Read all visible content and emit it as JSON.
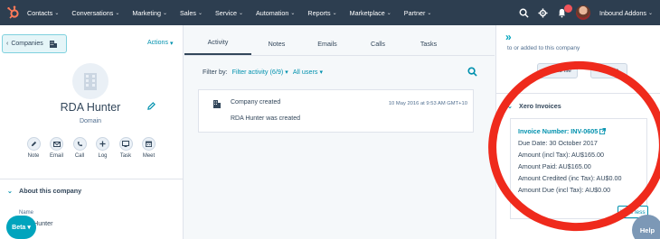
{
  "topnav": {
    "items": [
      {
        "label": "Contacts"
      },
      {
        "label": "Conversations"
      },
      {
        "label": "Marketing"
      },
      {
        "label": "Sales"
      },
      {
        "label": "Service"
      },
      {
        "label": "Automation"
      },
      {
        "label": "Reports"
      },
      {
        "label": "Marketplace"
      },
      {
        "label": "Partner"
      }
    ],
    "account_label": "Inbound Addons"
  },
  "left": {
    "back_label": "Companies",
    "actions_label": "Actions",
    "company_name": "RDA Hunter",
    "domain": "Domain",
    "action_buttons": [
      {
        "label": "Note",
        "icon": "note-icon"
      },
      {
        "label": "Email",
        "icon": "email-icon"
      },
      {
        "label": "Call",
        "icon": "call-icon"
      },
      {
        "label": "Log",
        "icon": "plus-icon"
      },
      {
        "label": "Task",
        "icon": "task-icon"
      },
      {
        "label": "Meet",
        "icon": "calendar-icon"
      }
    ],
    "about_title": "About this company",
    "field_label": "Name",
    "field_value": "Hunter",
    "beta_label": "Beta"
  },
  "middle": {
    "tabs": [
      {
        "label": "Activity"
      },
      {
        "label": "Notes"
      },
      {
        "label": "Emails"
      },
      {
        "label": "Calls"
      },
      {
        "label": "Tasks"
      }
    ],
    "filter_by": "Filter by:",
    "filter_activity": "Filter activity (6/9)",
    "all_users": "All users",
    "card": {
      "title": "Company created",
      "time": "10 May 2016 at 9:53 AM GMT+10",
      "body": "RDA Hunter was created"
    }
  },
  "right": {
    "cut_text": "to or added to this company",
    "upload_label": "Upload file",
    "add_label": "Add file",
    "xero_title": "Xero Invoices",
    "invoice_number": "Invoice Number: INV-0605",
    "rows": [
      {
        "text": "Due Date:  30 October 2017"
      },
      {
        "text": "Amount (incl Tax):  AU$165.00"
      },
      {
        "text": "Amount Paid:  AU$165.00"
      },
      {
        "text": "Amount Credited (inc Tax):  AU$0.00"
      },
      {
        "text": "Amount Due (incl Tax):  AU$0.00"
      }
    ],
    "view_less": "View less",
    "help_label": "Help"
  },
  "colors": {
    "nav_bg": "#2d3e50",
    "accent": "#00a4bd",
    "link": "#0091ae",
    "highlight": "#ef2a1c",
    "hubspot_orange": "#ff7a59"
  }
}
